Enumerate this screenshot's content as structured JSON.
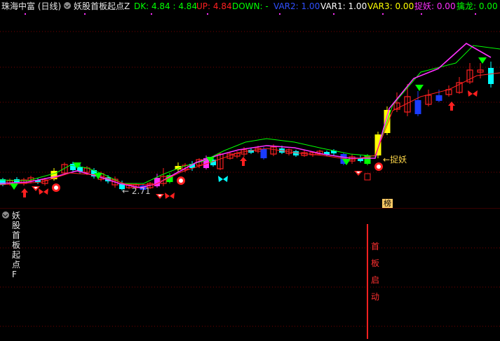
{
  "header": {
    "stock_title": "珠海中富 (日线)",
    "indicator_name": "妖股首板起点Z",
    "values": [
      {
        "label": "DK: 4.84 : 4.84",
        "color": "#00ff00"
      },
      {
        "label": "UP: 4.84",
        "color": "#ff2020"
      },
      {
        "label": "DOWN: -",
        "color": "#00ff00"
      },
      {
        "label": "VAR2: 1.00",
        "color": "#3050ff"
      },
      {
        "label": "VAR1: 1.00",
        "color": "#ffffff"
      },
      {
        "label": "VAR3: 0.00",
        "color": "#ffff00"
      },
      {
        "label": "捉妖: 0.00",
        "color": "#ff30ff"
      },
      {
        "label": "擒龙: 0.00",
        "color": "#00ff00"
      }
    ]
  },
  "sub_panel": {
    "indicator_name": "妖股首板起点F",
    "vertical_label": [
      "首",
      "板",
      "启",
      "动"
    ]
  },
  "annotations": {
    "low_label": "2.71",
    "catch_label": "捉妖",
    "rank_label": "榜"
  },
  "colors": {
    "up": "#ff2020",
    "down": "#00ffff",
    "ma_green": "#00ff00",
    "ma_magenta": "#ff30ff",
    "yellow_bar": "#ffff00",
    "blue_bar": "#1a3cff",
    "grid": "#7a0000"
  }
}
